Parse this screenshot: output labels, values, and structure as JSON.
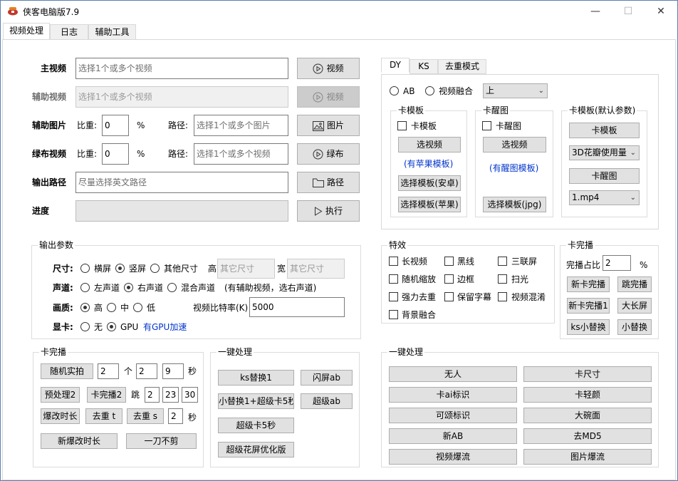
{
  "app": {
    "title": "侠客电脑版7.9",
    "minimize": "—",
    "maximize": "☐",
    "close": "✕"
  },
  "tabs": [
    "视频处理",
    "日志",
    "辅助工具"
  ],
  "main_video": {
    "label": "主视频",
    "placeholder": "选择1个或多个视频",
    "button": "视频"
  },
  "aux_video": {
    "label": "辅助视频",
    "placeholder": "选择1个或多个视频",
    "button": "视频"
  },
  "aux_image": {
    "label": "辅助图片",
    "ratio_label": "比重:",
    "ratio": "0",
    "unit": "%",
    "path_label": "路径:",
    "placeholder": "选择1个或多个图片",
    "button": "图片"
  },
  "green_video": {
    "label": "绿布视频",
    "ratio_label": "比重:",
    "ratio": "0",
    "unit": "%",
    "path_label": "路径:",
    "placeholder": "选择1个或多个视频",
    "button": "绿布"
  },
  "output_path": {
    "label": "输出路径",
    "placeholder": "尽量选择英文路径",
    "button": "路径"
  },
  "progress": {
    "label": "进度",
    "value": 0,
    "button": "执行"
  },
  "output_params": {
    "title": "输出参数",
    "size_label": "尺寸:",
    "size_opts": [
      "横屏",
      "竖屏",
      "其他尺寸"
    ],
    "h_label": "高",
    "h_placeholder": "其它尺寸",
    "w_label": "宽",
    "w_placeholder": "其它尺寸",
    "audio_label": "声道:",
    "audio_opts": [
      "左声道",
      "右声道",
      "混合声道"
    ],
    "audio_note": "(有辅助视频，选右声道)",
    "quality_label": "画质:",
    "quality_opts": [
      "高",
      "中",
      "低"
    ],
    "bitrate_label": "视频比特率(K)",
    "bitrate": "5000",
    "gpu_label": "显卡:",
    "gpu_opts": [
      "无",
      "GPU"
    ],
    "gpu_note": "有GPU加速"
  },
  "right_tabs": [
    "DY",
    "KS",
    "去重模式"
  ],
  "dy": {
    "ab": "AB",
    "fusion": "视频融合",
    "position": "上",
    "card_tpl": {
      "title": "卡模板",
      "check": "卡模板",
      "btn_select": "选视频",
      "note": "(有苹果模板)",
      "btn_android": "选择模板(安卓)",
      "btn_apple": "选择模板(苹果)"
    },
    "card_wake": {
      "title": "卡醒图",
      "check": "卡醒图",
      "btn_select": "选视频",
      "note": "(有醒图模板)",
      "btn_jpg": "选择模板(jpg)"
    },
    "card_default": {
      "title": "卡模板(默认参数)",
      "btn_tpl": "卡模板",
      "select1": "3D花瓣使用量",
      "btn_wake": "卡醒图",
      "select2": "1.mp4"
    }
  },
  "effects": {
    "title": "特效",
    "items": [
      "长视频",
      "黑线",
      "三联屏",
      "随机缩放",
      "边框",
      "扫光",
      "强力去重",
      "保留字幕",
      "视频混淆",
      "背景融合"
    ]
  },
  "card_full": {
    "title": "卡完播",
    "ratio_label": "完播占比",
    "ratio": "2",
    "unit": "%",
    "buttons": [
      "新卡完播",
      "跳完播",
      "新卡完播1",
      "大长屏",
      "ks小替换",
      "小替换"
    ]
  },
  "card_play": {
    "title": "卡完播",
    "random_btn": "随机实拍",
    "n1": "2",
    "unit_ge": "个",
    "n2": "2",
    "n3": "9",
    "unit_sec": "秒",
    "pre2_btn": "预处理2",
    "card2_btn": "卡完播2",
    "jump_label": "跳",
    "j1": "2",
    "j2": "23",
    "j3": "30",
    "burst_btn": "爆改时长",
    "remove_t": "去重 t",
    "remove_s": "去重 s",
    "sec_val": "2",
    "sec_unit": "秒",
    "new_burst_btn": "新爆改时长",
    "nocut_btn": "一刀不剪"
  },
  "one_click_left": {
    "title": "一键处理",
    "buttons": [
      "ks替换1",
      "闪屏ab",
      "小替换1+超级卡5秒",
      "超级ab",
      "超级卡5秒",
      "超级花屏优化版"
    ]
  },
  "one_click_right": {
    "title": "一键处理",
    "buttons": [
      "无人",
      "卡尺寸",
      "卡ai标识",
      "卡轻颜",
      "可颂标识",
      "大碗面",
      "新AB",
      "去MD5",
      "视频爆流",
      "图片爆流"
    ]
  }
}
